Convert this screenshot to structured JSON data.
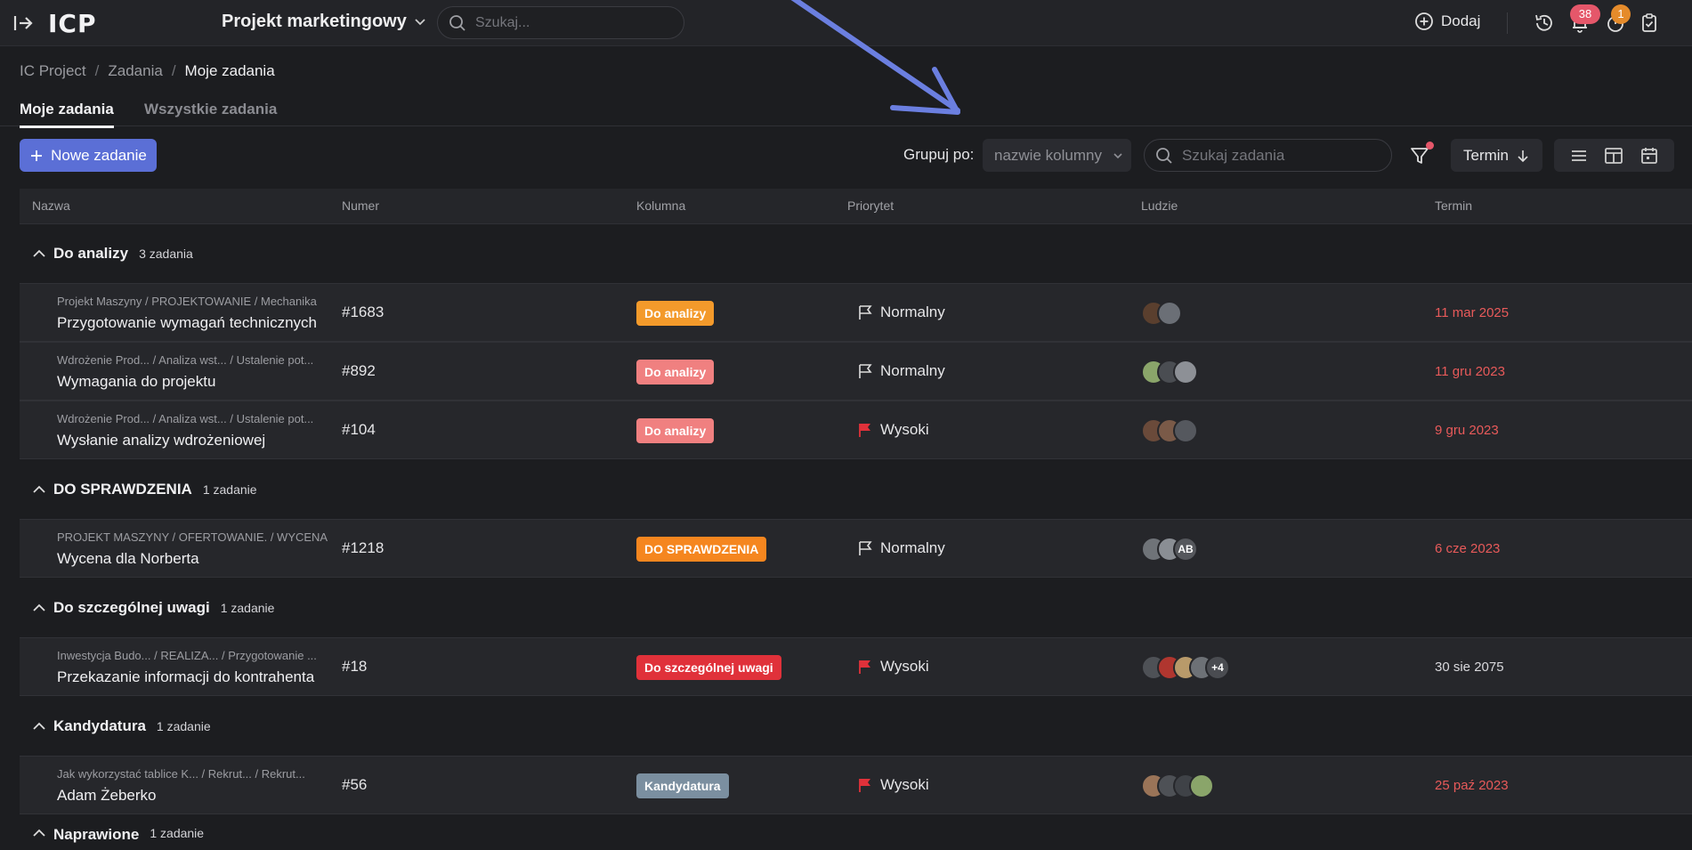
{
  "topbar": {
    "logo": "ICP",
    "project": "Projekt marketingowy",
    "search_placeholder": "Szukaj...",
    "add_label": "Dodaj",
    "notifications_count": "38",
    "tasks_count": "1"
  },
  "breadcrumb": {
    "items": [
      "IC Project",
      "Zadania",
      "Moje zadania"
    ]
  },
  "tabs": [
    {
      "label": "Moje zadania",
      "active": true
    },
    {
      "label": "Wszystkie zadania",
      "active": false
    }
  ],
  "toolbar": {
    "new_task_label": "Nowe zadanie",
    "group_label": "Grupuj po:",
    "group_value": "nazwie kolumny",
    "search_placeholder": "Szukaj zadania",
    "sort_label": "Termin"
  },
  "table": {
    "columns": [
      "Nazwa",
      "Numer",
      "Kolumna",
      "Priorytet",
      "Ludzie",
      "Termin"
    ],
    "groups": [
      {
        "name": "Do analizy",
        "count": "3 zadania"
      },
      {
        "name": "DO SPRAWDZENIA",
        "count": "1 zadanie"
      },
      {
        "name": "Do szczególnej uwagi",
        "count": "1 zadanie"
      },
      {
        "name": "Kandydatura",
        "count": "1 zadanie"
      },
      {
        "name": "Naprawione",
        "count": "1 zadanie"
      }
    ],
    "rows": [
      {
        "path": "Projekt Maszyny / PROJEKTOWANIE / Mechanika",
        "name": "Przygotowanie wymagań technicznych",
        "number": "#1683",
        "column": "Do analizy",
        "priority": "Normalny",
        "due": "11 mar 2025"
      },
      {
        "path": "Wdrożenie Prod... / Analiza wst... / Ustalenie pot...",
        "name": "Wymagania do projektu",
        "number": "#892",
        "column": "Do analizy",
        "priority": "Normalny",
        "due": "11 gru 2023"
      },
      {
        "path": "Wdrożenie Prod... / Analiza wst... / Ustalenie pot...",
        "name": "Wysłanie analizy wdrożeniowej",
        "number": "#104",
        "column": "Do analizy",
        "priority": "Wysoki",
        "due": "9 gru 2023"
      },
      {
        "path": "PROJEKT MASZYNY / OFERTOWANIE. / WYCENA",
        "name": "Wycena dla Norberta",
        "number": "#1218",
        "column": "DO SPRAWDZENIA",
        "priority": "Normalny",
        "due": "6 cze 2023",
        "people_initials": "AB"
      },
      {
        "path": "Inwestycja Budo... / REALIZA... / Przygotowanie ...",
        "name": "Przekazanie informacji do kontrahenta",
        "number": "#18",
        "column": "Do szczególnej uwagi",
        "priority": "Wysoki",
        "due": "30 sie 2075",
        "people_more": "+4"
      },
      {
        "path": "Jak wykorzystać tablice K... / Rekrut... / Rekrut...",
        "name": "Adam Żeberko",
        "number": "#56",
        "column": "Kandydatura",
        "priority": "Wysoki",
        "due": "25 paź 2023"
      }
    ]
  },
  "colors": {
    "accent": "#5b6fd6",
    "col_do_analizy": "#f08080",
    "col_do_analizy_first": "#f39a2b",
    "col_do_sprawdzenia": "#f5861f",
    "col_do_szczegolnej": "#e0313a",
    "col_kandydatura": "#7b8fa0",
    "priority_high": "#e0313a",
    "overdue": "#e85a5a"
  }
}
